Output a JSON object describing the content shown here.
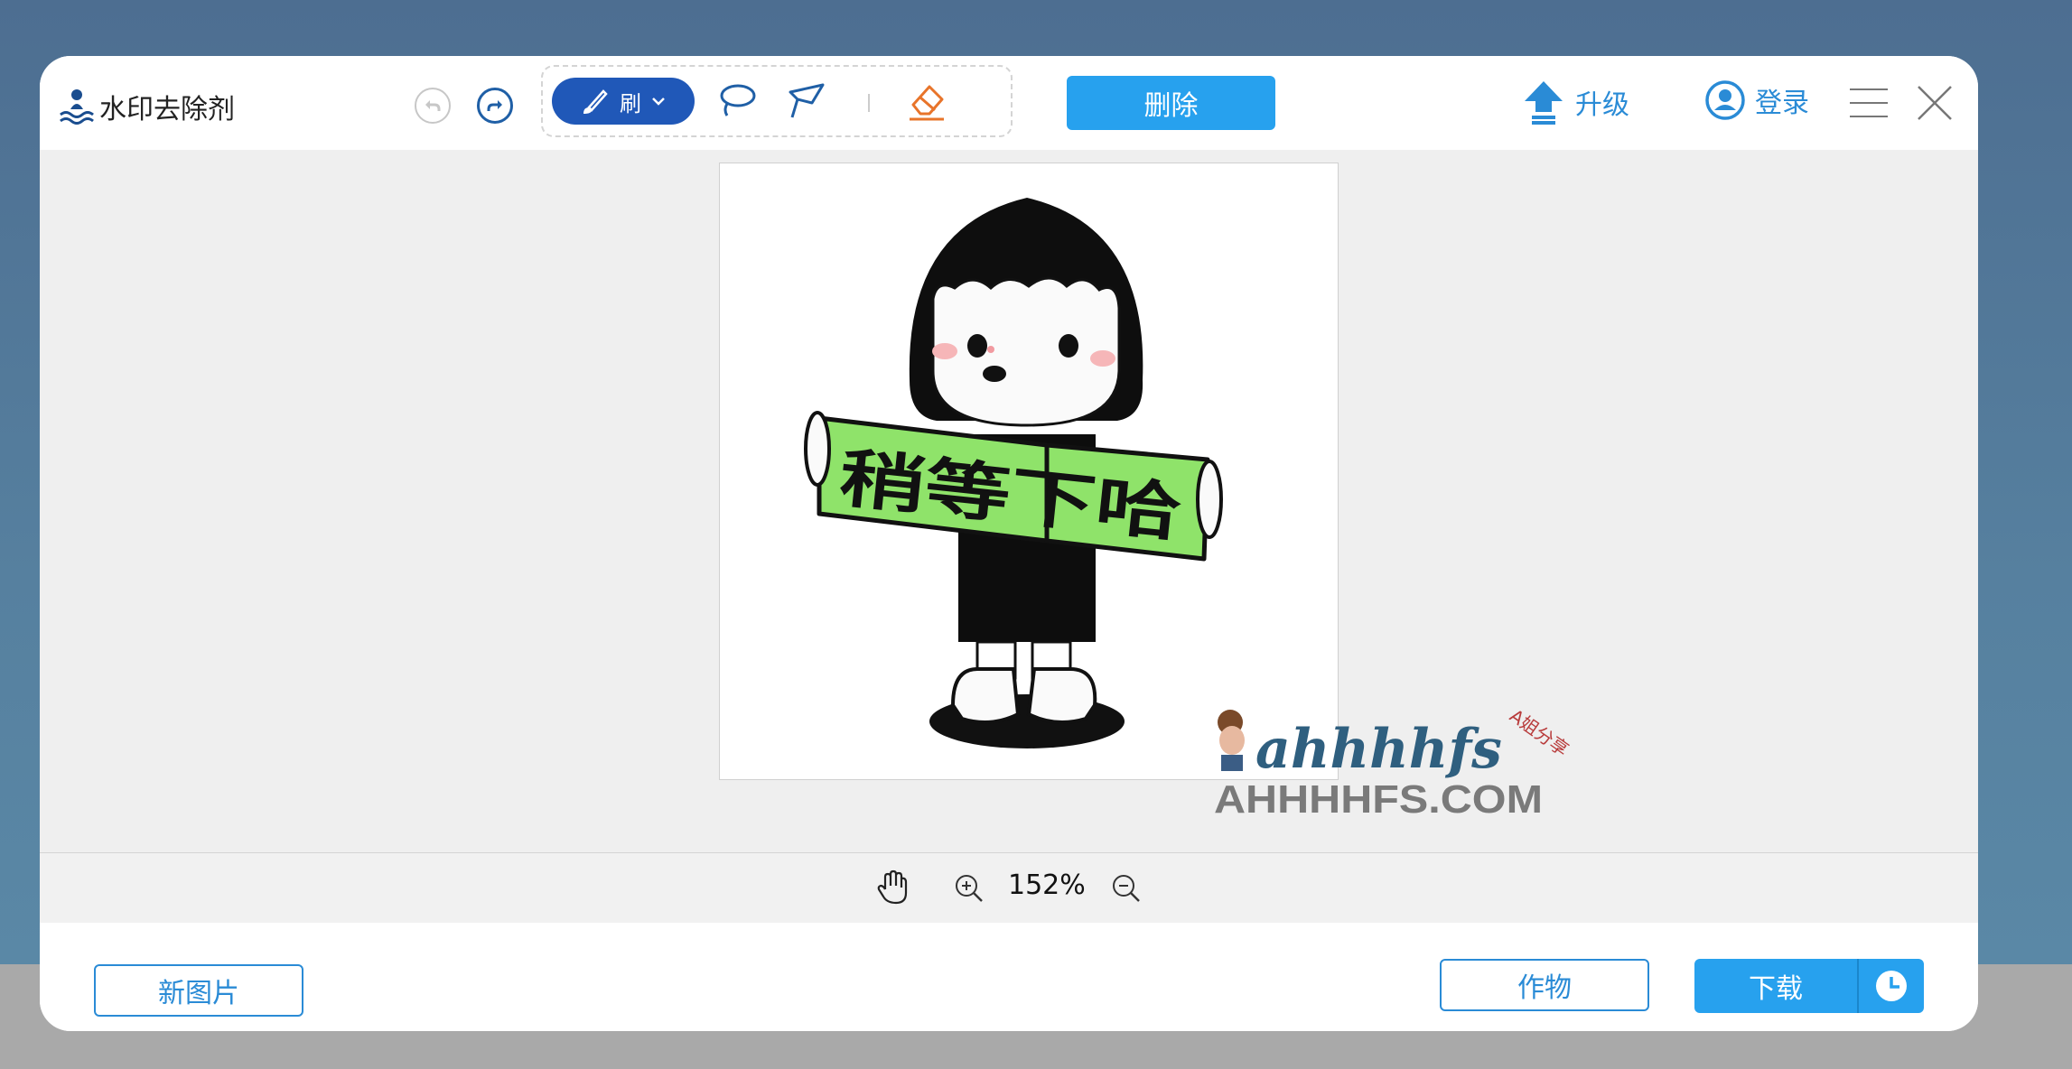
{
  "app": {
    "name": "水印去除剂"
  },
  "toolbar": {
    "brush_label": "刷",
    "delete_label": "删除",
    "upgrade_label": "升级",
    "login_label": "登录"
  },
  "canvas": {
    "sign_text": "稍等下哈",
    "watermark_text": "ahhhhfs",
    "watermark_tag": "A姐分享",
    "watermark_domain": "AHHHHFS.COM"
  },
  "zoom": {
    "value": "152%"
  },
  "footer": {
    "new_image_label": "新图片",
    "works_label": "作物",
    "download_label": "下载"
  },
  "colors": {
    "accent": "#27a1ee",
    "brush_active": "#2058b8",
    "link": "#2a8bd6",
    "eraser": "#e8742a",
    "canvas_bg": "#efefef",
    "sign_green": "#8fe36a"
  }
}
